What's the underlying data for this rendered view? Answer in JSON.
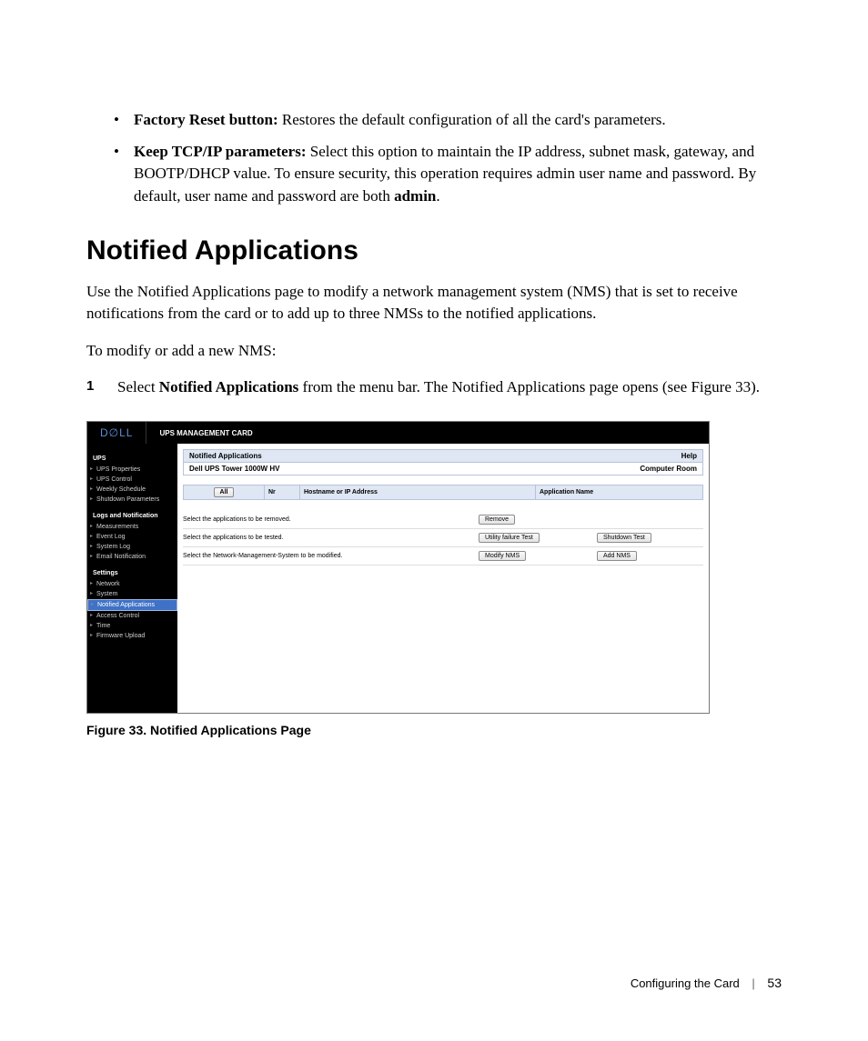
{
  "bullets": [
    {
      "label": "Factory Reset button:",
      "text": " Restores the default configuration of all the card's parameters."
    },
    {
      "label": "Keep TCP/IP parameters:",
      "text": " Select this option to maintain the IP address, subnet mask, gateway, and BOOTP/DHCP value. To ensure security, this operation requires admin user name and password. By default, user name and password are both ",
      "tail_bold": "admin",
      "tail": "."
    }
  ],
  "section_title": "Notified Applications",
  "intro": "Use the Notified Applications page to modify a network management system (NMS) that is set to receive notifications from the card or to add up to three NMSs to the notified applications.",
  "lead": "To modify or add a new NMS:",
  "step": {
    "num": "1",
    "pre": "Select ",
    "bold": "Notified Applications",
    "post": " from the menu bar. The Notified Applications page opens (see Figure 33)."
  },
  "shot": {
    "logo": "D∅LL",
    "top_title": "UPS MANAGEMENT CARD",
    "sidebar": {
      "groups": [
        {
          "header": "UPS",
          "items": [
            "UPS Properties",
            "UPS Control",
            "Weekly Schedule",
            "Shutdown Parameters"
          ]
        },
        {
          "header": "Logs and Notification",
          "items": [
            "Measurements",
            "Event Log",
            "System Log",
            "Email Notification"
          ]
        },
        {
          "header": "Settings",
          "items": [
            "Network",
            "System",
            "Notified Applications",
            "Access Control",
            "Time",
            "Firmware Upload"
          ],
          "selected": "Notified Applications"
        }
      ]
    },
    "panel": {
      "title": "Notified Applications",
      "help": "Help",
      "device": "Dell UPS Tower 1000W HV",
      "location": "Computer Room"
    },
    "table": {
      "all_btn": "All",
      "cols": [
        "",
        "Nr",
        "Hostname or IP Address",
        "Application Name"
      ]
    },
    "rows": [
      {
        "label": "Select the applications to be removed.",
        "b1": "Remove",
        "b2": ""
      },
      {
        "label": "Select the applications to be tested.",
        "b1": "Utility failure Test",
        "b2": "Shutdown Test"
      },
      {
        "label": "Select the Network-Management-System to be modified.",
        "b1": "Modify NMS",
        "b2": "Add NMS"
      }
    ]
  },
  "figure_caption": "Figure 33. Notified Applications Page",
  "footer": {
    "chapter": "Configuring the Card",
    "page": "53"
  }
}
